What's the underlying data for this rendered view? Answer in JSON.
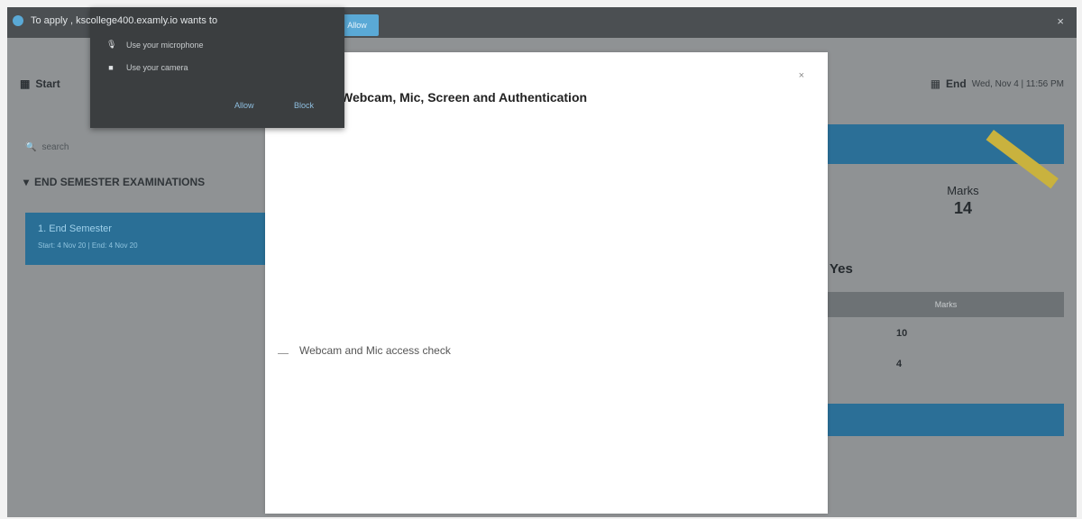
{
  "permission_popup": {
    "title": "To apply , kscollege400.examly.io wants to",
    "items": [
      {
        "icon": "microphone-icon",
        "label": "Use your microphone"
      },
      {
        "icon": "camera-icon",
        "label": "Use your camera"
      }
    ],
    "allow_label": "Allow",
    "block_label": "Block"
  },
  "background": {
    "start_label": "Start",
    "end_label": "End",
    "end_date": "Wed, Nov 4 | 11:56 PM",
    "search_placeholder": "search",
    "sidebar_heading": "END SEMESTER EXAMINATIONS",
    "sidebar_item": {
      "title": "1. End Semester",
      "subtitle": "Start: 4 Nov 20 | End: 4 Nov 20"
    },
    "marks_label": "Marks",
    "marks_value": "14",
    "yes_text": "Yes",
    "table_header": "Marks",
    "rows": [
      "10",
      "4"
    ],
    "blue_button_label": "Allow"
  },
  "modal": {
    "title": "Webcam, Mic, Screen and Authentication",
    "check_item_label": "Webcam and Mic access check",
    "close_symbol": "×"
  }
}
